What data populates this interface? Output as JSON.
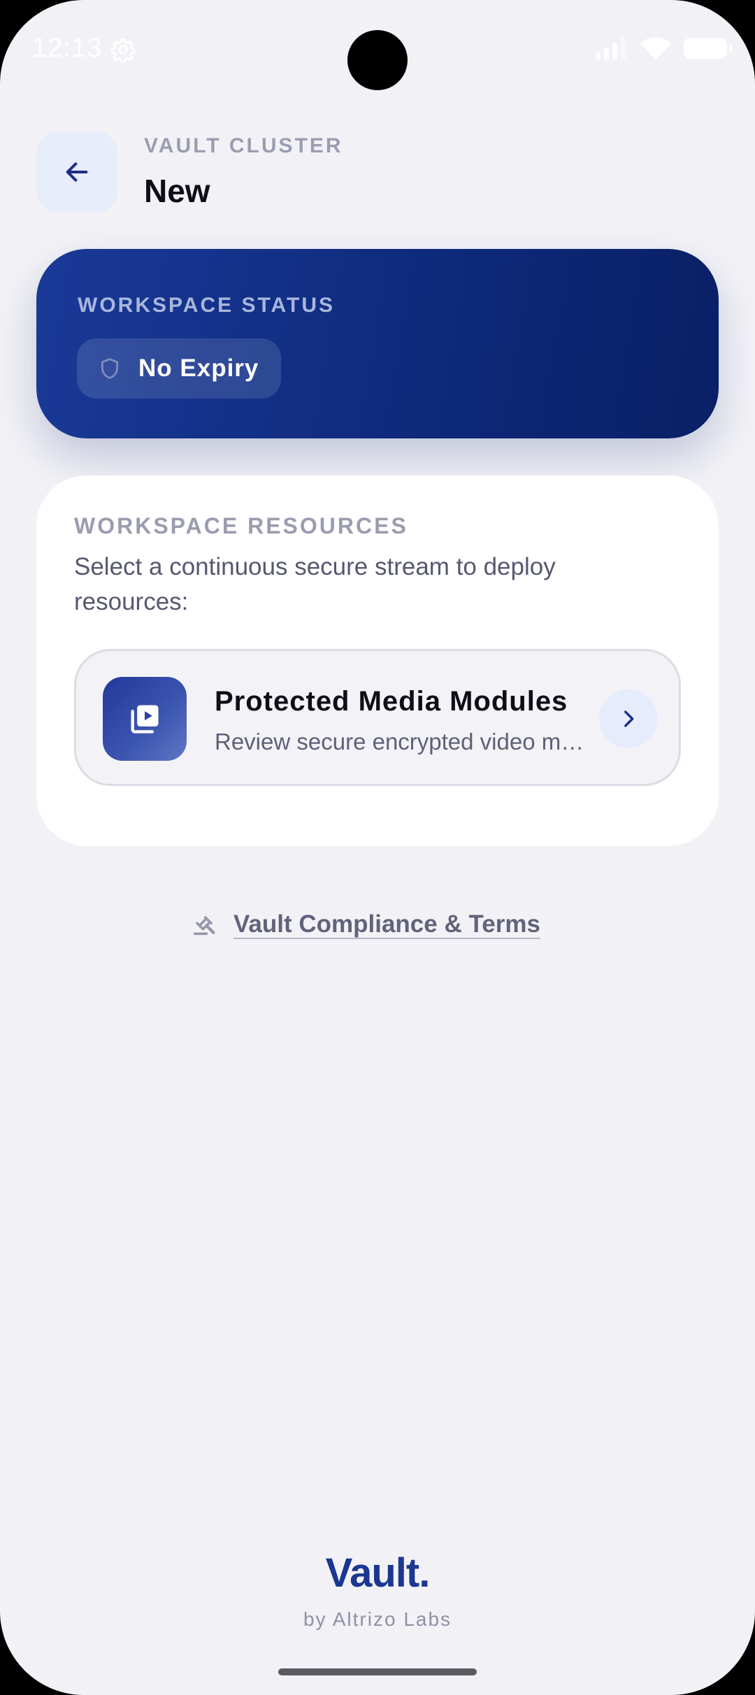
{
  "status_bar": {
    "time": "12:13",
    "gear_icon": "gear-icon",
    "signal_icon": "signal-icon",
    "wifi_icon": "wifi-icon",
    "battery_icon": "battery-icon"
  },
  "header": {
    "back_icon": "arrow-left-icon",
    "eyebrow": "VAULT CLUSTER",
    "title": "New"
  },
  "workspace_status": {
    "label": "WORKSPACE STATUS",
    "chip_icon": "shield-icon",
    "chip_text": "No Expiry"
  },
  "workspace_resources": {
    "label": "WORKSPACE RESOURCES",
    "description": "Select a continuous secure stream to deploy resources:",
    "module": {
      "icon": "video-library-icon",
      "title": "Protected Media Modules",
      "subtitle": "Review secure encrypted video modules",
      "chevron_icon": "chevron-right-icon"
    }
  },
  "compliance": {
    "icon": "gavel-icon",
    "label": "Vault Compliance & Terms"
  },
  "footer": {
    "brand": "Vault.",
    "byline": "by Altrizo Labs"
  },
  "colors": {
    "background": "#f2f2f6",
    "accent": "#1b3791",
    "status_card_start": "#1a3a98",
    "status_card_end": "#0a1f66",
    "card": "#ffffff",
    "muted_text": "#9a9caf"
  }
}
